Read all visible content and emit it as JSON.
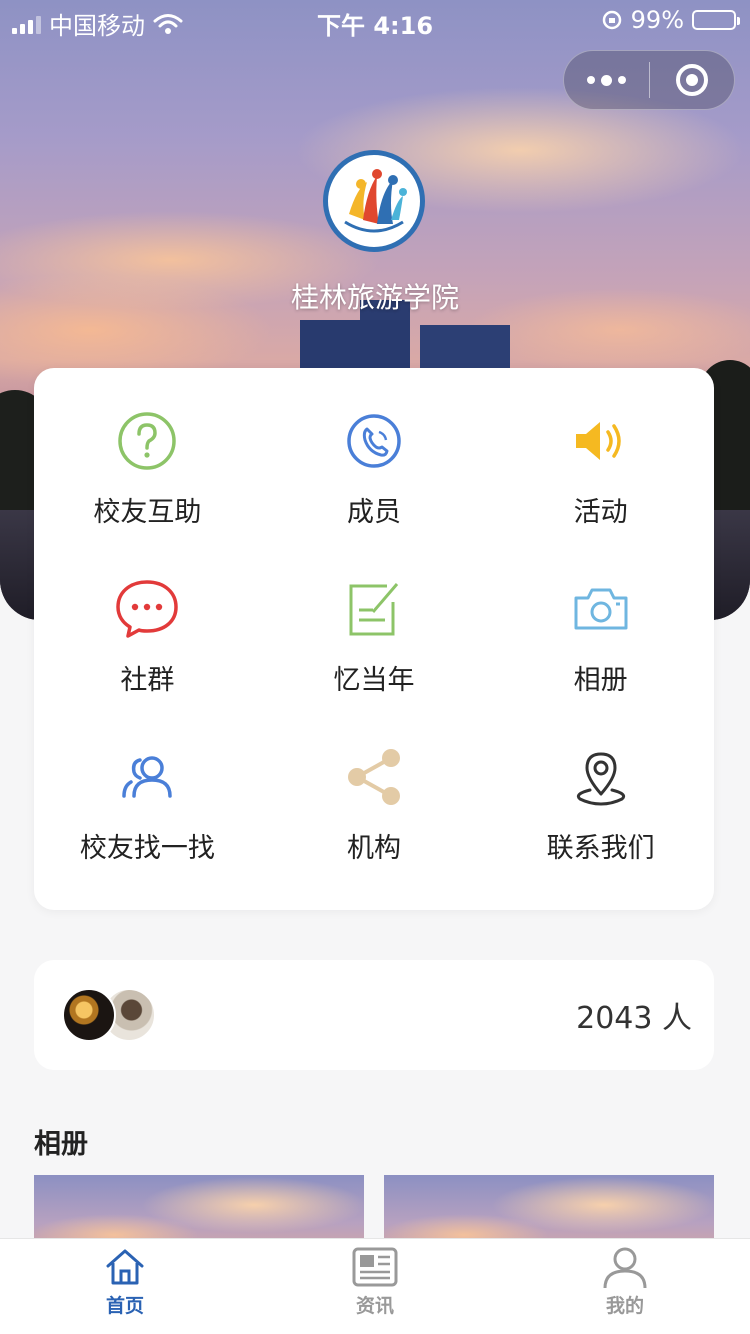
{
  "status_bar": {
    "carrier": "中国移动",
    "time": "下午 4:16",
    "battery": "99%"
  },
  "header": {
    "school_name": "桂林旅游学院"
  },
  "menu": [
    {
      "label": "校友互助",
      "icon": "question-circle-icon",
      "color": "#8dc468"
    },
    {
      "label": "成员",
      "icon": "phone-circle-icon",
      "color": "#4a7fd8"
    },
    {
      "label": "活动",
      "icon": "speaker-icon",
      "color": "#f5b921"
    },
    {
      "label": "社群",
      "icon": "chat-bubble-icon",
      "color": "#e23a3a"
    },
    {
      "label": "忆当年",
      "icon": "note-edit-icon",
      "color": "#8dc468"
    },
    {
      "label": "相册",
      "icon": "camera-icon",
      "color": "#6fb6e0"
    },
    {
      "label": "校友找一找",
      "icon": "users-icon",
      "color": "#4a7fd8"
    },
    {
      "label": "机构",
      "icon": "share-icon",
      "color": "#e3cba6"
    },
    {
      "label": "联系我们",
      "icon": "location-pin-icon",
      "color": "#333333"
    }
  ],
  "members": {
    "count_text": "2043 人"
  },
  "album": {
    "title": "相册"
  },
  "tabbar": {
    "tabs": [
      {
        "label": "首页",
        "icon": "home-icon",
        "active": true
      },
      {
        "label": "资讯",
        "icon": "newspaper-icon",
        "active": false
      },
      {
        "label": "我的",
        "icon": "user-icon",
        "active": false
      }
    ],
    "active_color": "#2a62b3",
    "inactive_color": "#999999"
  }
}
